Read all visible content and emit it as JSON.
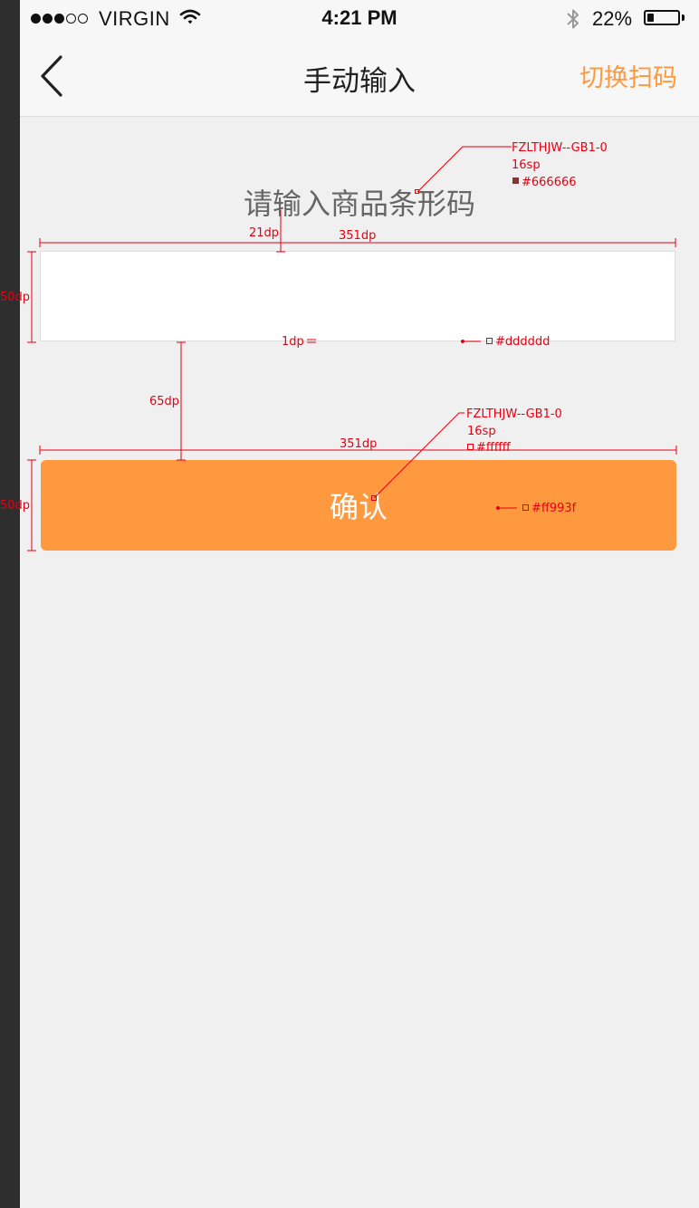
{
  "status_bar": {
    "carrier": "VIRGIN",
    "time": "4:21 PM",
    "battery_percent": "22%",
    "battery_level": 0.22,
    "signal_bars_filled": 3,
    "signal_bars_total": 5,
    "icons": [
      "wifi-icon",
      "bluetooth-icon",
      "battery-icon"
    ]
  },
  "nav": {
    "back_icon": "chevron-left-icon",
    "title": "手动输入",
    "switch_label": "切换扫码"
  },
  "content": {
    "prompt": "请输入商品条形码",
    "input_value": "",
    "confirm_label": "确认"
  },
  "colors": {
    "accent": "#ff993f",
    "prompt_text": "#666666",
    "input_border": "#dddddd",
    "button_text": "#ffffff",
    "annotation": "#e60012"
  },
  "annotations": {
    "prompt_font": "FZLTHJW--GB1-0",
    "prompt_size": "16sp",
    "prompt_color": "#666666",
    "gap_top": "21dp",
    "input_width": "351dp",
    "input_height": "50dp",
    "border_width": "1dp",
    "border_color": "#dddddd",
    "gap_middle": "65dp",
    "button_font": "FZLTHJW--GB1-0",
    "button_size": "16sp",
    "button_text_color": "#ffffff",
    "button_width": "351dp",
    "button_height": "50dp",
    "button_color": "#ff993f"
  }
}
